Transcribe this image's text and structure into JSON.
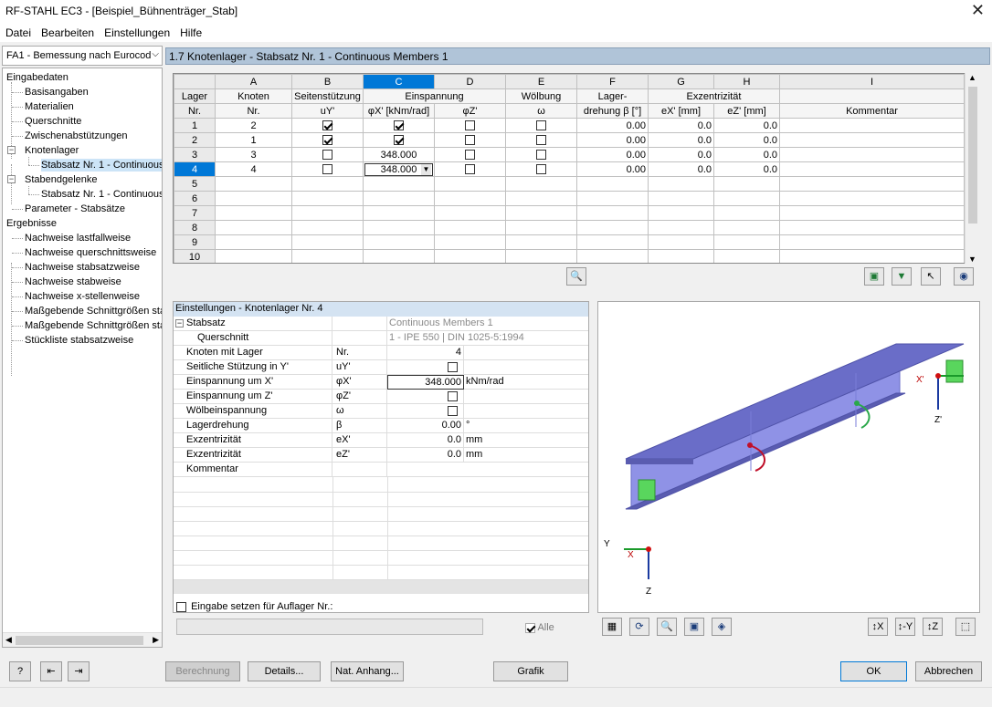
{
  "window": {
    "title": "RF-STAHL EC3 - [Beispiel_Bühnenträger_Stab]",
    "close": "✕"
  },
  "menu": [
    "Datei",
    "Bearbeiten",
    "Einstellungen",
    "Hilfe"
  ],
  "module_select": {
    "value": "FA1 - Bemessung nach Eurocod"
  },
  "navtree": {
    "input_root": "Eingabedaten",
    "items": [
      "Basisangaben",
      "Materialien",
      "Querschnitte",
      "Zwischenabstützungen",
      "Knotenlager",
      "Stabsatz Nr. 1 - Continuous",
      "Stabendgelenke",
      "Stabsatz Nr. 1 - Continuous",
      "Parameter - Stabsätze"
    ],
    "results_root": "Ergebnisse",
    "results": [
      "Nachweise lastfallweise",
      "Nachweise querschnittsweise",
      "Nachweise stabsatzweise",
      "Nachweise stabweise",
      "Nachweise x-stellenweise",
      "Maßgebende Schnittgrößen sta",
      "Maßgebende Schnittgrößen sta",
      "Stückliste stabsatzweise"
    ]
  },
  "main_header": "1.7 Knotenlager - Stabsatz Nr. 1 - Continuous Members 1",
  "grid": {
    "col_letters": [
      "A",
      "B",
      "C",
      "D",
      "E",
      "F",
      "G",
      "H",
      "I"
    ],
    "row_hdr_1": "Lager",
    "row_hdr_2": "Nr.",
    "h1": [
      "Knoten",
      "Seitenstützung",
      "Einspannung",
      "Wölbung",
      "Lager-",
      "Exzentrizität",
      "Kommentar"
    ],
    "h2": [
      "Nr.",
      "uY'",
      "φX' [kNm/rad]",
      "φZ'",
      "ω",
      "drehung β [°]",
      "eX' [mm]",
      "eZ' [mm]"
    ],
    "rows": [
      {
        "nr": "1",
        "knoten": "2",
        "uy": true,
        "phix": "check",
        "phiz": false,
        "omega": false,
        "beta": "0.00",
        "ex": "0.0",
        "ez": "0.0"
      },
      {
        "nr": "2",
        "knoten": "1",
        "uy": true,
        "phix": "check",
        "phiz": false,
        "omega": false,
        "beta": "0.00",
        "ex": "0.0",
        "ez": "0.0"
      },
      {
        "nr": "3",
        "knoten": "3",
        "uy": false,
        "phix": "348.000",
        "phiz": false,
        "omega": false,
        "beta": "0.00",
        "ex": "0.0",
        "ez": "0.0"
      },
      {
        "nr": "4",
        "knoten": "4",
        "uy": false,
        "phix": "348.000",
        "phiz": false,
        "omega": false,
        "beta": "0.00",
        "ex": "0.0",
        "ez": "0.0"
      }
    ],
    "empty_rows": [
      "5",
      "6",
      "7",
      "8",
      "9",
      "10"
    ],
    "active_row": "4",
    "active_col": "C"
  },
  "settings": {
    "header": "Einstellungen - Knotenlager Nr. 4",
    "stabsatz_label": "Stabsatz",
    "stabsatz_value": "Continuous Members 1",
    "querschnitt_label": "Querschnitt",
    "querschnitt_value": "1 - IPE 550 | DIN 1025-5:1994",
    "rows": [
      {
        "label": "Knoten mit Lager",
        "sym": "Nr.",
        "value": "4",
        "unit": ""
      },
      {
        "label": "Seitliche Stützung in Y'",
        "sym": "uY'",
        "value": "",
        "unit": "",
        "checkbox": true
      },
      {
        "label": "Einspannung um X'",
        "sym": "φX'",
        "value": "348.000",
        "unit": "kNm/rad"
      },
      {
        "label": "Einspannung um Z'",
        "sym": "φZ'",
        "value": "",
        "unit": "",
        "checkbox": true
      },
      {
        "label": "Wölbeinspannung",
        "sym": "ω",
        "value": "",
        "unit": "",
        "checkbox": true
      },
      {
        "label": "Lagerdrehung",
        "sym": "β",
        "value": "0.00",
        "unit": "°"
      },
      {
        "label": "Exzentrizität",
        "sym": "eX'",
        "value": "0.0",
        "unit": "mm"
      },
      {
        "label": "Exzentrizität",
        "sym": "eZ'",
        "value": "0.0",
        "unit": "mm"
      },
      {
        "label": "Kommentar",
        "sym": "",
        "value": "",
        "unit": ""
      }
    ],
    "set_input_label": "Eingabe setzen für Auflager Nr.:",
    "alle_label": "Alle"
  },
  "graphic": {
    "axis_x": "X",
    "axis_y": "Y",
    "axis_z": "Z",
    "axis_xp": "X'",
    "axis_zp": "Z'",
    "beam_color": "#8f92e6"
  },
  "buttons": {
    "berechnung": "Berechnung",
    "details": "Details...",
    "nat_anhang": "Nat. Anhang...",
    "grafik": "Grafik",
    "ok": "OK",
    "abbrechen": "Abbrechen"
  }
}
